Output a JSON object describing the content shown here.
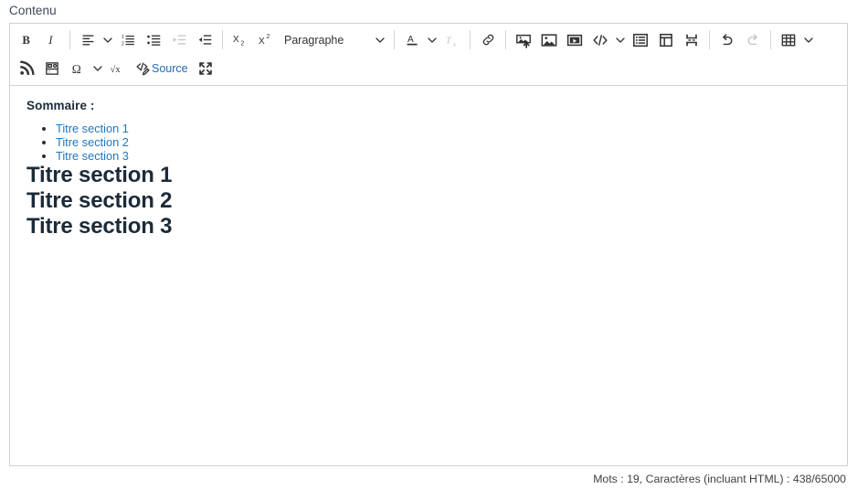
{
  "field": {
    "label": "Contenu"
  },
  "toolbar": {
    "row1": [
      {
        "name": "bold-button",
        "icon": "bold",
        "label": "B",
        "disabled": false,
        "caret": false
      },
      {
        "name": "italic-button",
        "icon": "italic",
        "label": "I",
        "disabled": false,
        "caret": false
      },
      {
        "name": "separator-1",
        "icon": "separator"
      },
      {
        "name": "text-alignment-button",
        "icon": "align-left",
        "disabled": false,
        "caret": true
      },
      {
        "name": "numbered-list-button",
        "icon": "numbered-list",
        "disabled": false,
        "caret": false
      },
      {
        "name": "bulleted-list-button",
        "icon": "bulleted-list",
        "disabled": false,
        "caret": false
      },
      {
        "name": "decrease-indent-button",
        "icon": "outdent",
        "disabled": true,
        "caret": false
      },
      {
        "name": "increase-indent-button",
        "icon": "indent",
        "disabled": false,
        "caret": false
      },
      {
        "name": "separator-2",
        "icon": "separator"
      },
      {
        "name": "subscript-button",
        "icon": "subscript",
        "disabled": false,
        "caret": false
      },
      {
        "name": "superscript-button",
        "icon": "superscript",
        "disabled": false,
        "caret": false
      },
      {
        "name": "paragraph-style-dropdown",
        "icon": "paragraph-dropdown",
        "value": "Paragraphe",
        "caret": true
      },
      {
        "name": "separator-3",
        "icon": "separator"
      },
      {
        "name": "font-color-button",
        "icon": "font-color",
        "disabled": false,
        "caret": true
      },
      {
        "name": "remove-format-button",
        "icon": "remove-format",
        "disabled": true,
        "caret": false
      },
      {
        "name": "separator-4",
        "icon": "separator"
      },
      {
        "name": "link-button",
        "icon": "link",
        "disabled": false,
        "caret": false
      },
      {
        "name": "separator-5",
        "icon": "separator"
      },
      {
        "name": "upload-image-button",
        "icon": "image-upload",
        "disabled": false,
        "caret": false
      },
      {
        "name": "insert-image-button",
        "icon": "image",
        "disabled": false,
        "caret": false
      },
      {
        "name": "insert-media-button",
        "icon": "media",
        "disabled": false,
        "caret": false
      },
      {
        "name": "code-block-button",
        "icon": "code-block",
        "disabled": false,
        "caret": true
      },
      {
        "name": "list-properties-button",
        "icon": "list-block",
        "disabled": false,
        "caret": false
      },
      {
        "name": "template-button",
        "icon": "template",
        "disabled": false,
        "caret": false
      },
      {
        "name": "page-break-button",
        "icon": "page-break",
        "disabled": false,
        "caret": false
      },
      {
        "name": "separator-6",
        "icon": "separator"
      },
      {
        "name": "undo-button",
        "icon": "undo",
        "disabled": false,
        "caret": false
      },
      {
        "name": "redo-button",
        "icon": "redo",
        "disabled": true,
        "caret": false
      },
      {
        "name": "separator-7",
        "icon": "separator"
      },
      {
        "name": "insert-table-button",
        "icon": "table",
        "disabled": false,
        "caret": true
      }
    ],
    "row2": [
      {
        "name": "rss-feed-button",
        "icon": "rss",
        "disabled": false,
        "caret": false
      },
      {
        "name": "insert-widget-button",
        "icon": "widget",
        "disabled": false,
        "caret": false
      },
      {
        "name": "special-characters-button",
        "icon": "omega",
        "disabled": false,
        "caret": true
      },
      {
        "name": "math-formula-button",
        "icon": "math",
        "disabled": false,
        "caret": false
      },
      {
        "name": "source-editing-button",
        "icon": "source",
        "label": "Source",
        "disabled": false,
        "caret": false
      },
      {
        "name": "fullscreen-button",
        "icon": "fullscreen",
        "disabled": false,
        "caret": false
      }
    ]
  },
  "content": {
    "summary_heading": "Sommaire :",
    "toc_links": [
      "Titre section 1",
      "Titre section 2",
      "Titre section 3"
    ],
    "sections": [
      "Titre section 1",
      "Titre section 2",
      "Titre section 3"
    ]
  },
  "statusbar": {
    "text": "Mots : 19, Caractères (incluant HTML) : 438/65000"
  },
  "colors": {
    "link": "#2276bd",
    "source_label": "#1f6bb0",
    "heading": "#1c2b39",
    "border": "#cfd1d3",
    "disabled": "#c4c6c8"
  }
}
